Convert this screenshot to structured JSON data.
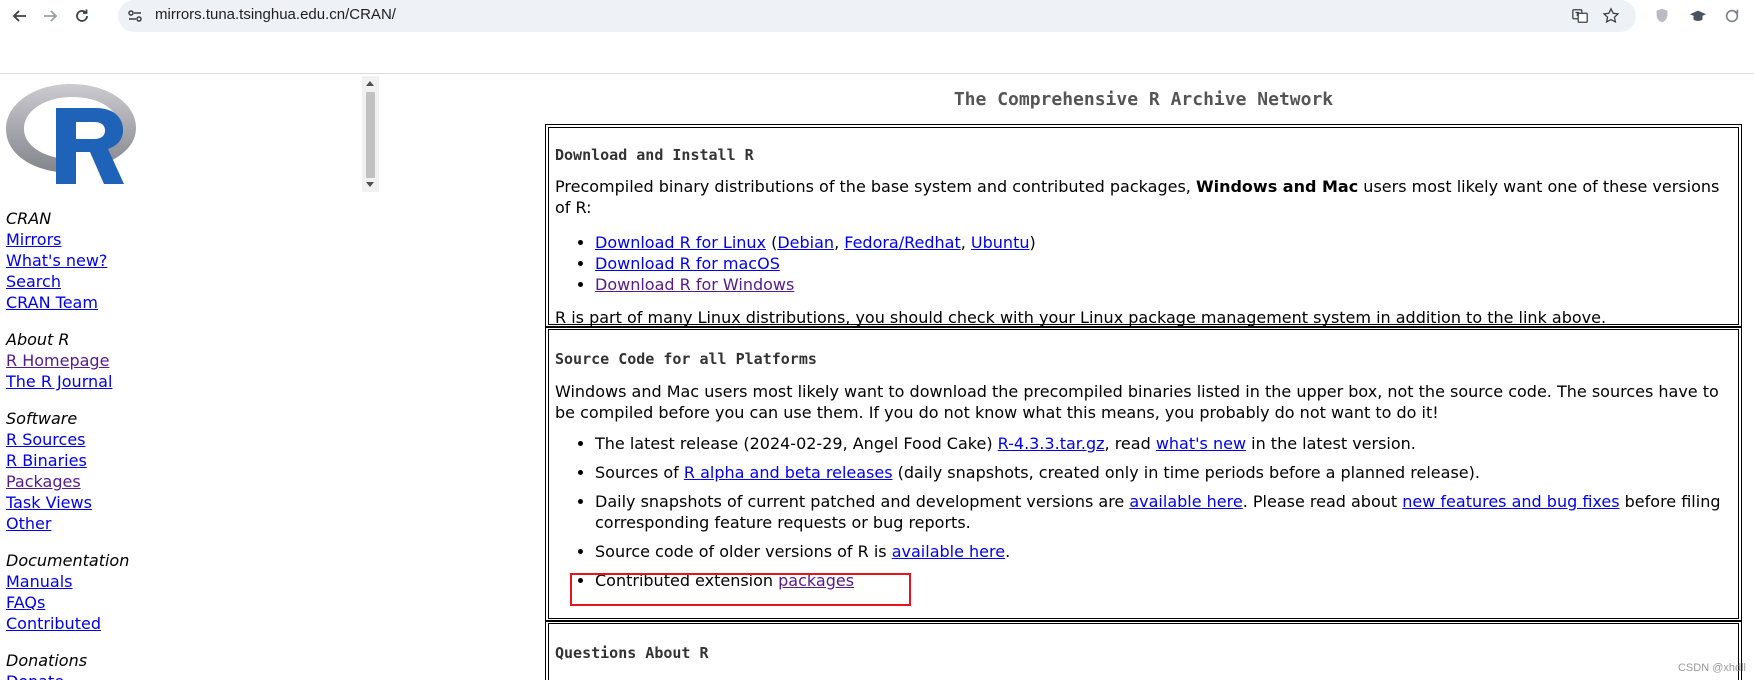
{
  "browser": {
    "url": "mirrors.tuna.tsinghua.edu.cn/CRAN/"
  },
  "sidebar": {
    "groups": [
      {
        "heading": "CRAN",
        "links": [
          {
            "label": "Mirrors",
            "visited": false
          },
          {
            "label": "What's new?",
            "visited": false
          },
          {
            "label": "Search",
            "visited": false
          },
          {
            "label": "CRAN Team",
            "visited": false
          }
        ]
      },
      {
        "heading": "About R",
        "links": [
          {
            "label": "R Homepage",
            "visited": true
          },
          {
            "label": "The R Journal",
            "visited": false
          }
        ]
      },
      {
        "heading": "Software",
        "links": [
          {
            "label": "R Sources",
            "visited": false
          },
          {
            "label": "R Binaries",
            "visited": false
          },
          {
            "label": "Packages",
            "visited": true
          },
          {
            "label": "Task Views",
            "visited": false
          },
          {
            "label": "Other",
            "visited": false
          }
        ]
      },
      {
        "heading": "Documentation",
        "links": [
          {
            "label": "Manuals",
            "visited": false
          },
          {
            "label": "FAQs",
            "visited": false
          },
          {
            "label": "Contributed",
            "visited": false
          }
        ]
      },
      {
        "heading": "Donations",
        "links": [
          {
            "label": "Donate",
            "visited": false
          }
        ]
      }
    ]
  },
  "main": {
    "title": "The Comprehensive R Archive Network",
    "download": {
      "heading": "Download and Install R",
      "intro_pre": "Precompiled binary distributions of the base system and contributed packages, ",
      "intro_bold": "Windows and Mac",
      "intro_post": " users most likely want one of these versions of R:",
      "linux_link": "Download R for Linux",
      "linux_open": " (",
      "debian": "Debian",
      "comma1": ", ",
      "fedora": "Fedora/Redhat",
      "comma2": ", ",
      "ubuntu": "Ubuntu",
      "linux_close": ")",
      "macos_link": "Download R for macOS",
      "windows_link": "Download R for Windows",
      "footer": "R is part of many Linux distributions, you should check with your Linux package management system in addition to the link above."
    },
    "source": {
      "heading": "Source Code for all Platforms",
      "intro": "Windows and Mac users most likely want to download the precompiled binaries listed in the upper box, not the source code. The sources have to be compiled before you can use them. If you do not know what this means, you probably do not want to do it!",
      "item1_pre": "The latest release (2024-02-29, Angel Food Cake) ",
      "item1_link1": "R-4.3.3.tar.gz",
      "item1_mid": ", read ",
      "item1_link2": "what's new",
      "item1_post": " in the latest version.",
      "item2_pre": "Sources of ",
      "item2_link": "R alpha and beta releases",
      "item2_post": " (daily snapshots, created only in time periods before a planned release).",
      "item3_pre": "Daily snapshots of current patched and development versions are ",
      "item3_link1": "available here",
      "item3_mid": ". Please read about ",
      "item3_link2": "new features and bug fixes",
      "item3_post": " before filing corresponding feature requests or bug reports.",
      "item4_pre": "Source code of older versions of R is ",
      "item4_link": "available here",
      "item4_post": ".",
      "item5_pre": "Contributed extension ",
      "item5_link": "packages"
    },
    "questions": {
      "heading": "Questions About R"
    }
  },
  "watermark": "CSDN @xhdll",
  "colors": {
    "link": "#0000ee",
    "visited": "#551a8b",
    "highlight": "#e8141c",
    "logo_ring": "#9a9aa0",
    "logo_letter": "#1f63b8"
  }
}
